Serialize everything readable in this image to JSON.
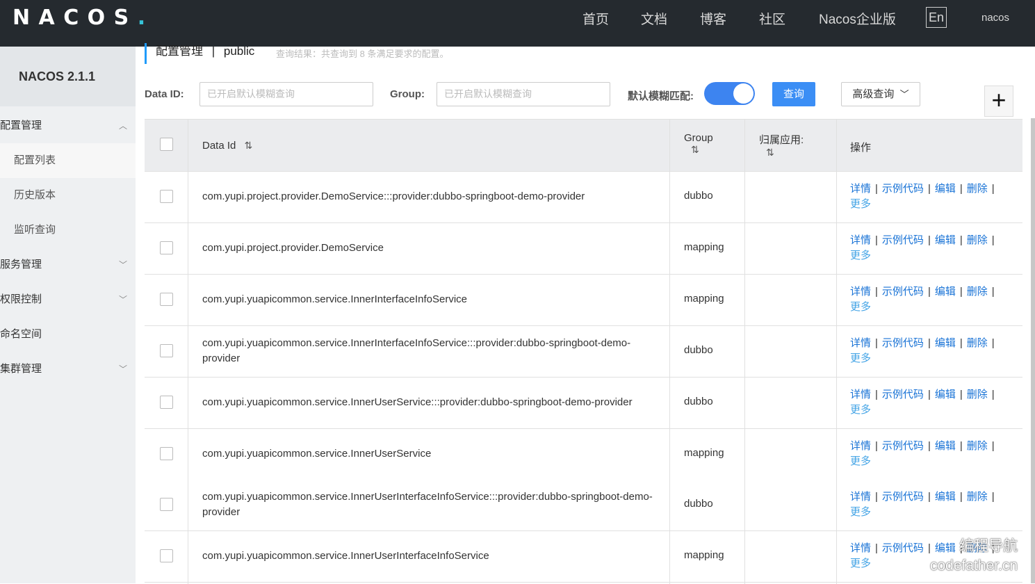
{
  "nav": {
    "logo": "NACOS.",
    "items": [
      "首页",
      "文档",
      "博客",
      "社区",
      "Nacos企业版"
    ],
    "lang": "En",
    "user": "nacos"
  },
  "sidebar": {
    "version": "NACOS 2.1.1",
    "items": [
      {
        "label": "配置管理",
        "chevron": "up"
      },
      {
        "label": "配置列表"
      },
      {
        "label": "历史版本"
      },
      {
        "label": "监听查询"
      },
      {
        "label": "服务管理",
        "chevron": "down"
      },
      {
        "label": "权限控制",
        "chevron": "down"
      },
      {
        "label": "命名空间"
      },
      {
        "label": "集群管理",
        "chevron": "down"
      }
    ]
  },
  "crumb": {
    "title": "配置管理",
    "sep": "|",
    "namespace": "public",
    "result": "查询结果：共查询到 8 条满足要求的配置。"
  },
  "filters": {
    "dataid_label": "Data ID:",
    "dataid_placeholder": "已开启默认模糊查询",
    "group_label": "Group:",
    "group_placeholder": "已开启默认模糊查询",
    "fuzzy_label": "默认模糊匹配:",
    "query_button": "查询",
    "advanced_button": "高级查询",
    "add_button": "+"
  },
  "table": {
    "headers": {
      "dataid": "Data Id",
      "group": "Group",
      "app": "归属应用:",
      "ops": "操作"
    },
    "op_labels": {
      "detail": "详情",
      "sample": "示例代码",
      "edit": "编辑",
      "delete": "删除",
      "more": "更多",
      "sep": "|"
    },
    "rows": [
      {
        "dataid": "com.yupi.project.provider.DemoService:::provider:dubbo-springboot-demo-provider",
        "group": "dubbo"
      },
      {
        "dataid": "com.yupi.project.provider.DemoService",
        "group": "mapping"
      },
      {
        "dataid": "com.yupi.yuapicommon.service.InnerInterfaceInfoService",
        "group": "mapping"
      },
      {
        "dataid": "com.yupi.yuapicommon.service.InnerInterfaceInfoService:::provider:dubbo-springboot-demo-provider",
        "group": "dubbo"
      },
      {
        "dataid": "com.yupi.yuapicommon.service.InnerUserService:::provider:dubbo-springboot-demo-provider",
        "group": "dubbo"
      },
      {
        "dataid": "com.yupi.yuapicommon.service.InnerUserService",
        "group": "mapping"
      },
      {
        "dataid": "com.yupi.yuapicommon.service.InnerUserInterfaceInfoService:::provider:dubbo-springboot-demo-provider",
        "group": "dubbo"
      },
      {
        "dataid": "com.yupi.yuapicommon.service.InnerUserInterfaceInfoService",
        "group": "mapping"
      }
    ]
  },
  "watermark": {
    "line1": "编程导航",
    "line2": "codefather.cn"
  }
}
